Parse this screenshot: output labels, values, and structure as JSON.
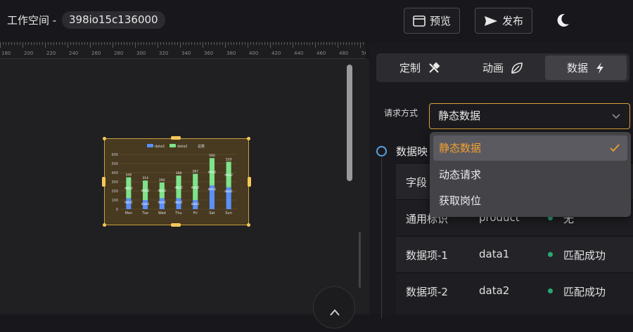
{
  "header": {
    "workspace_label": "工作空间 -",
    "workspace_id": "398io15c136000",
    "preview_label": "预览",
    "publish_label": "发布",
    "icons": [
      "preview-window-icon",
      "send-icon",
      "moon-icon"
    ]
  },
  "ruler": {
    "ticks": [
      "180",
      "200",
      "220",
      "240",
      "260",
      "280",
      "300",
      "320",
      "340",
      "360",
      "380",
      "400",
      "420",
      "440",
      "460",
      "480",
      "500"
    ]
  },
  "chart_data": {
    "type": "bar",
    "categories": [
      "Mon",
      "Tue",
      "Wed",
      "Thu",
      "Fri",
      "Sat",
      "Sun"
    ],
    "series": [
      {
        "name": "data1",
        "values": [
          120,
          100,
          120,
          120,
          100,
          260,
          240
        ],
        "color": "#5b8ff9"
      },
      {
        "name": "data2",
        "values": [
          349,
          314,
          292,
          368,
          387,
          560,
          520
        ],
        "color": "#7ee38b"
      }
    ],
    "legend": [
      "data1",
      "data2",
      "总数"
    ],
    "ylim": [
      0,
      600
    ],
    "yticks": [
      "0",
      "100",
      "200",
      "300",
      "400",
      "500",
      "600"
    ],
    "totals": [
      "349",
      "314",
      "292",
      "368",
      "387",
      "560",
      "520"
    ],
    "stacked": true,
    "grid": true
  },
  "right_panel": {
    "tabs": [
      {
        "label": "定制",
        "icon": "tools-icon"
      },
      {
        "label": "动画",
        "icon": "leaf-icon"
      },
      {
        "label": "数据",
        "icon": "lightning-icon"
      }
    ],
    "active_tab": "数据",
    "request_label": "请求方式",
    "request_value": "静态数据",
    "section_title": "数据映",
    "table": {
      "header_first": "字段",
      "rows": [
        {
          "field": "通用标识",
          "value": "product",
          "status": "无"
        },
        {
          "field": "数据项-1",
          "value": "data1",
          "status": "匹配成功"
        },
        {
          "field": "数据项-2",
          "value": "data2",
          "status": "匹配成功"
        }
      ]
    }
  },
  "dropdown": {
    "options": [
      "静态数据",
      "动态请求",
      "获取岗位"
    ],
    "selected": "静态数据"
  },
  "colors": {
    "accent": "#f0a030",
    "success": "#2aa872",
    "timeline": "#5aa0e0"
  }
}
